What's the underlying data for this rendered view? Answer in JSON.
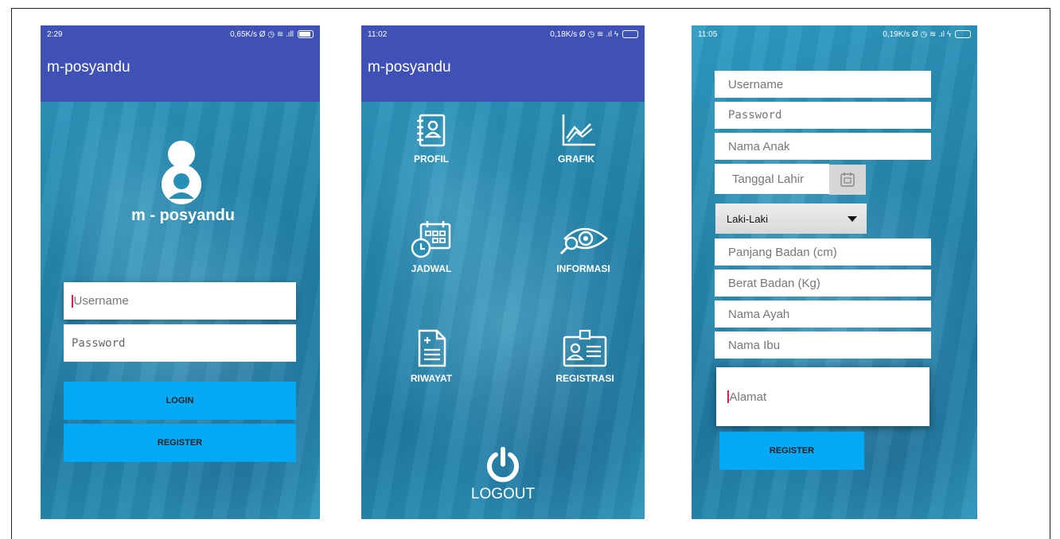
{
  "screen1": {
    "status": {
      "time": "2:29",
      "net": "0,65K/s Ø ◷ ≋ .ıll"
    },
    "app_title": "m-posyandu",
    "logo_text": "m - posyandu",
    "username_placeholder": "Username",
    "password_placeholder": "Password",
    "login_label": "LOGIN",
    "register_label": "REGISTER"
  },
  "screen2": {
    "status": {
      "time": "11:02",
      "net": "0,18K/s Ø ◷ ≋ .ıl ϟ"
    },
    "app_title": "m-posyandu",
    "menu": [
      {
        "label": "PROFIL",
        "icon": "profile-book-icon"
      },
      {
        "label": "GRAFIK",
        "icon": "chart-icon"
      },
      {
        "label": "JADWAL",
        "icon": "calendar-clock-icon"
      },
      {
        "label": "INFORMASI",
        "icon": "eye-search-icon"
      },
      {
        "label": "RIWAYAT",
        "icon": "document-icon"
      },
      {
        "label": "REGISTRASI",
        "icon": "id-card-icon"
      }
    ],
    "logout_label": "LOGOUT"
  },
  "screen3": {
    "status": {
      "time": "11:05",
      "net": "0,19K/s Ø ◷ ≋ .ıl ϟ"
    },
    "fields": {
      "username": "Username",
      "password": "Password",
      "nama_anak": "Nama Anak",
      "tanggal_lahir": "Tanggal Lahir",
      "gender_selected": "Laki-Laki",
      "panjang_badan": "Panjang Badan (cm)",
      "berat_badan": "Berat Badan (Kg)",
      "nama_ayah": "Nama Ayah",
      "nama_ibu": "Nama Ibu",
      "alamat": "Alamat"
    },
    "register_label": "REGISTER"
  },
  "colors": {
    "appbar": "#3f51b5",
    "button": "#03a9f4",
    "background_tint": "#2a8fb5"
  }
}
